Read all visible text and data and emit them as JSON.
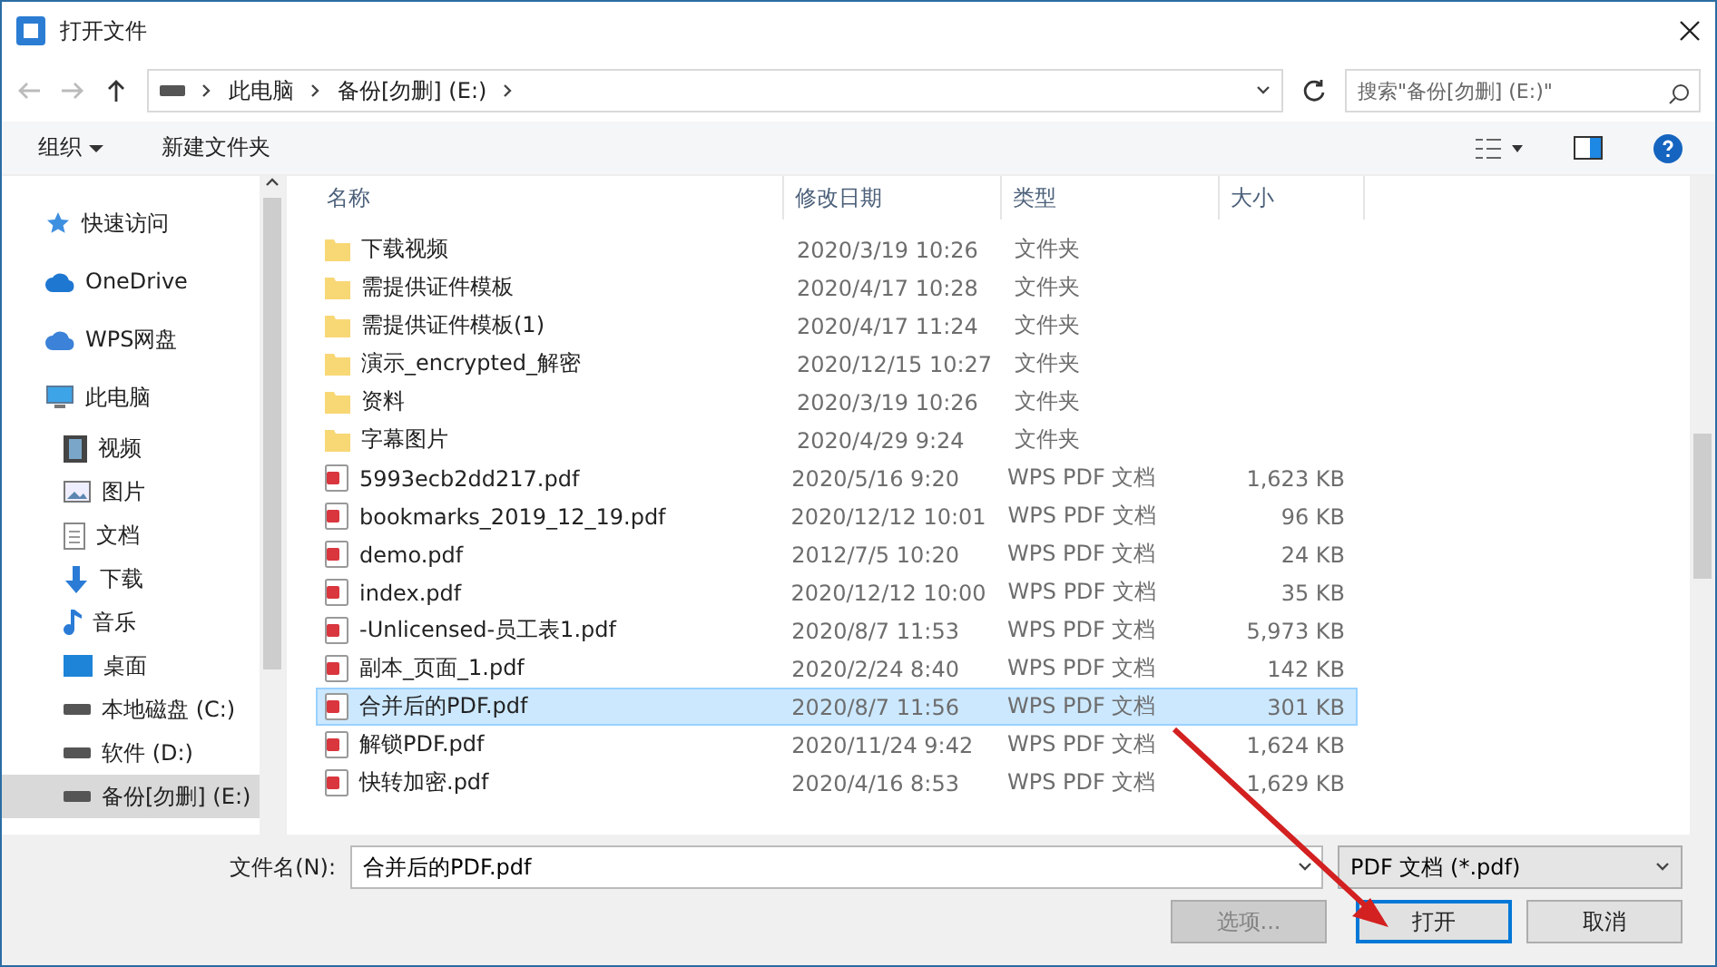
{
  "window": {
    "title": "打开文件"
  },
  "address": {
    "crumbs": [
      "此电脑",
      "备份[勿删] (E:)"
    ],
    "search_placeholder": "搜索\"备份[勿删] (E:)\""
  },
  "toolbar": {
    "organize": "组织",
    "new_folder": "新建文件夹"
  },
  "sidebar": {
    "items": [
      {
        "label": "快速访问",
        "kind": "star",
        "selected": false
      },
      {
        "label": "OneDrive",
        "kind": "cloud",
        "selected": false
      },
      {
        "label": "WPS网盘",
        "kind": "wps",
        "selected": false
      },
      {
        "label": "此电脑",
        "kind": "pc",
        "selected": false,
        "children": [
          {
            "label": "视频",
            "kind": "video",
            "selected": false
          },
          {
            "label": "图片",
            "kind": "image",
            "selected": false
          },
          {
            "label": "文档",
            "kind": "doc",
            "selected": false
          },
          {
            "label": "下载",
            "kind": "download",
            "selected": false
          },
          {
            "label": "音乐",
            "kind": "music",
            "selected": false
          },
          {
            "label": "桌面",
            "kind": "desktop",
            "selected": false
          },
          {
            "label": "本地磁盘 (C:)",
            "kind": "drive",
            "selected": false
          },
          {
            "label": "软件 (D:)",
            "kind": "drive",
            "selected": false
          },
          {
            "label": "备份[勿删] (E:)",
            "kind": "drive",
            "selected": true
          }
        ]
      }
    ]
  },
  "table": {
    "columns": [
      "名称",
      "修改日期",
      "类型",
      "大小"
    ],
    "rows": [
      {
        "name": "下载视频",
        "date": "2020/3/19 10:26",
        "type": "文件夹",
        "kind": "folder",
        "selected": false
      },
      {
        "name": "需提供证件模板",
        "date": "2020/4/17 10:28",
        "type": "文件夹",
        "kind": "folder",
        "selected": false
      },
      {
        "name": "需提供证件模板(1)",
        "date": "2020/4/17 11:24",
        "type": "文件夹",
        "kind": "folder",
        "selected": false
      },
      {
        "name": "演示_encrypted_解密",
        "date": "2020/12/15 10:27",
        "type": "文件夹",
        "kind": "folder",
        "selected": false
      },
      {
        "name": "资料",
        "date": "2020/3/19 10:26",
        "type": "文件夹",
        "kind": "folder",
        "selected": false
      },
      {
        "name": "字幕图片",
        "date": "2020/4/29 9:24",
        "type": "文件夹",
        "kind": "folder",
        "selected": false
      },
      {
        "name": "5993ecb2dd217.pdf",
        "date": "2020/5/16 9:20",
        "type": "WPS PDF 文档",
        "size": "1,623 KB",
        "kind": "pdf",
        "selected": false
      },
      {
        "name": "bookmarks_2019_12_19.pdf",
        "date": "2020/12/12 10:01",
        "type": "WPS PDF 文档",
        "size": "96 KB",
        "kind": "pdf",
        "selected": false
      },
      {
        "name": "demo.pdf",
        "date": "2012/7/5 10:20",
        "type": "WPS PDF 文档",
        "size": "24 KB",
        "kind": "pdf",
        "selected": false
      },
      {
        "name": "index.pdf",
        "date": "2020/12/12 10:00",
        "type": "WPS PDF 文档",
        "size": "35 KB",
        "kind": "pdf",
        "selected": false
      },
      {
        "name": "-Unlicensed-员工表1.pdf",
        "date": "2020/8/7 11:53",
        "type": "WPS PDF 文档",
        "size": "5,973 KB",
        "kind": "pdf",
        "selected": false
      },
      {
        "name": "副本_页面_1.pdf",
        "date": "2020/2/24 8:40",
        "type": "WPS PDF 文档",
        "size": "142 KB",
        "kind": "pdf",
        "selected": false
      },
      {
        "name": "合并后的PDF.pdf",
        "date": "2020/8/7 11:56",
        "type": "WPS PDF 文档",
        "size": "301 KB",
        "kind": "pdf",
        "selected": true
      },
      {
        "name": "解锁PDF.pdf",
        "date": "2020/11/24 9:42",
        "type": "WPS PDF 文档",
        "size": "1,624 KB",
        "kind": "pdf",
        "selected": false
      },
      {
        "name": "快转加密.pdf",
        "date": "2020/4/16 8:53",
        "type": "WPS PDF 文档",
        "size": "1,629 KB",
        "kind": "pdf",
        "selected": false
      }
    ]
  },
  "footer": {
    "filename_label": "文件名(N):",
    "filename": "合并后的PDF.pdf",
    "filter": "PDF 文档 (*.pdf)",
    "options": "选项...",
    "options_disabled": true,
    "open": "打开",
    "cancel": "取消"
  }
}
